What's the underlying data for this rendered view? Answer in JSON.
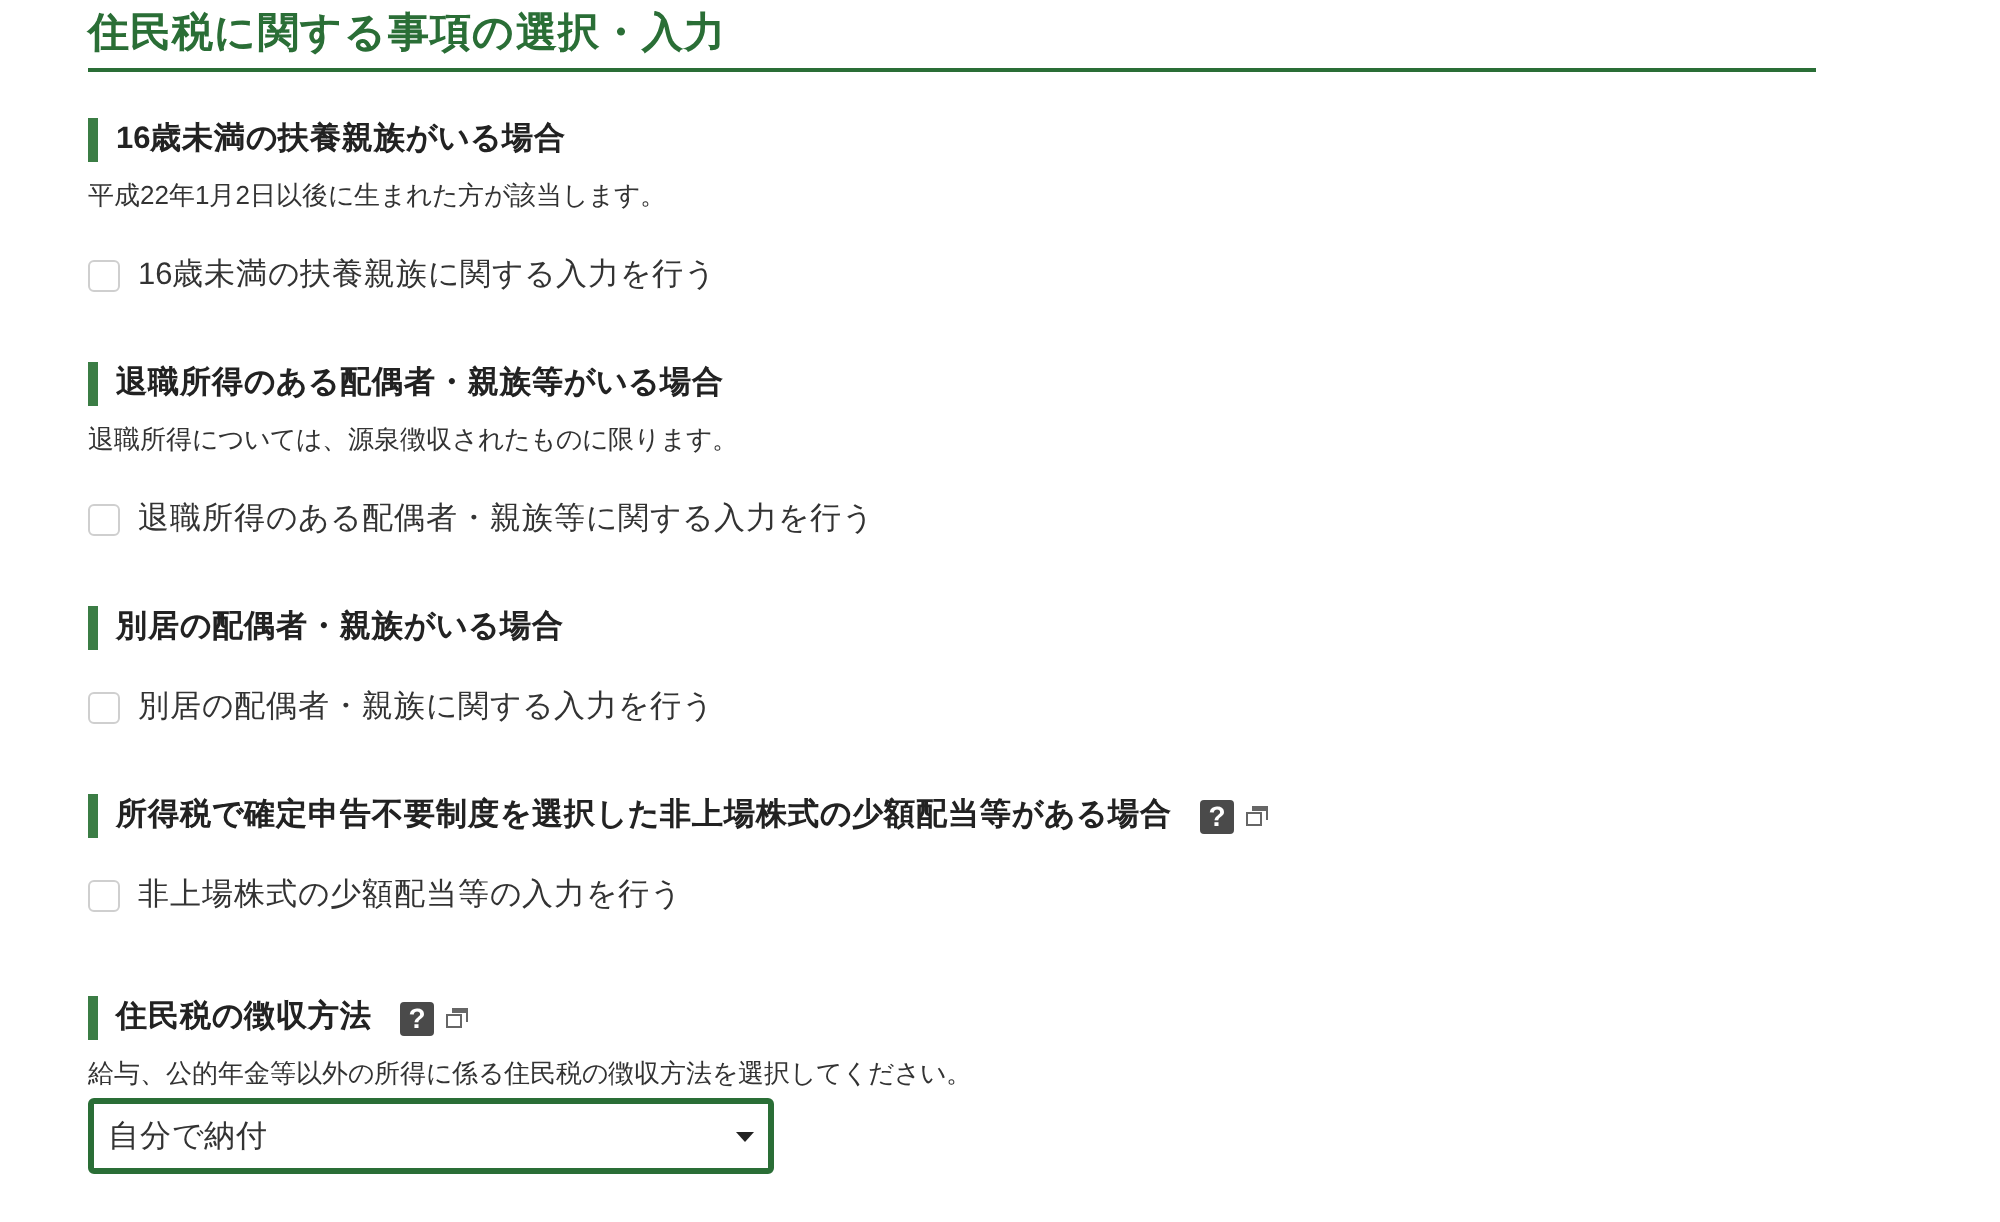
{
  "page": {
    "title": "住民税に関する事項の選択・入力"
  },
  "sections": [
    {
      "heading": "16歳未満の扶養親族がいる場合",
      "note": "平成22年1月2日以後に生まれた方が該当します。",
      "control": {
        "kind": "checkbox",
        "label": "16歳未満の扶養親族に関する入力を行う",
        "checked": false
      }
    },
    {
      "heading": "退職所得のある配偶者・親族等がいる場合",
      "note": "退職所得については、源泉徴収されたものに限ります。",
      "control": {
        "kind": "checkbox",
        "label": "退職所得のある配偶者・親族等に関する入力を行う",
        "checked": false
      }
    },
    {
      "heading": "別居の配偶者・親族がいる場合",
      "control": {
        "kind": "checkbox",
        "label": "別居の配偶者・親族に関する入力を行う",
        "checked": false
      }
    },
    {
      "heading": "所得税で確定申告不要制度を選択した非上場株式の少額配当等がある場合",
      "help": "?",
      "control": {
        "kind": "checkbox",
        "label": "非上場株式の少額配当等の入力を行う",
        "checked": false
      }
    },
    {
      "heading": "住民税の徴収方法",
      "help": "?",
      "note": "給与、公的年金等以外の所得に係る住民税の徴収方法を選択してください。",
      "control": {
        "kind": "select",
        "value": "自分で納付"
      }
    }
  ]
}
